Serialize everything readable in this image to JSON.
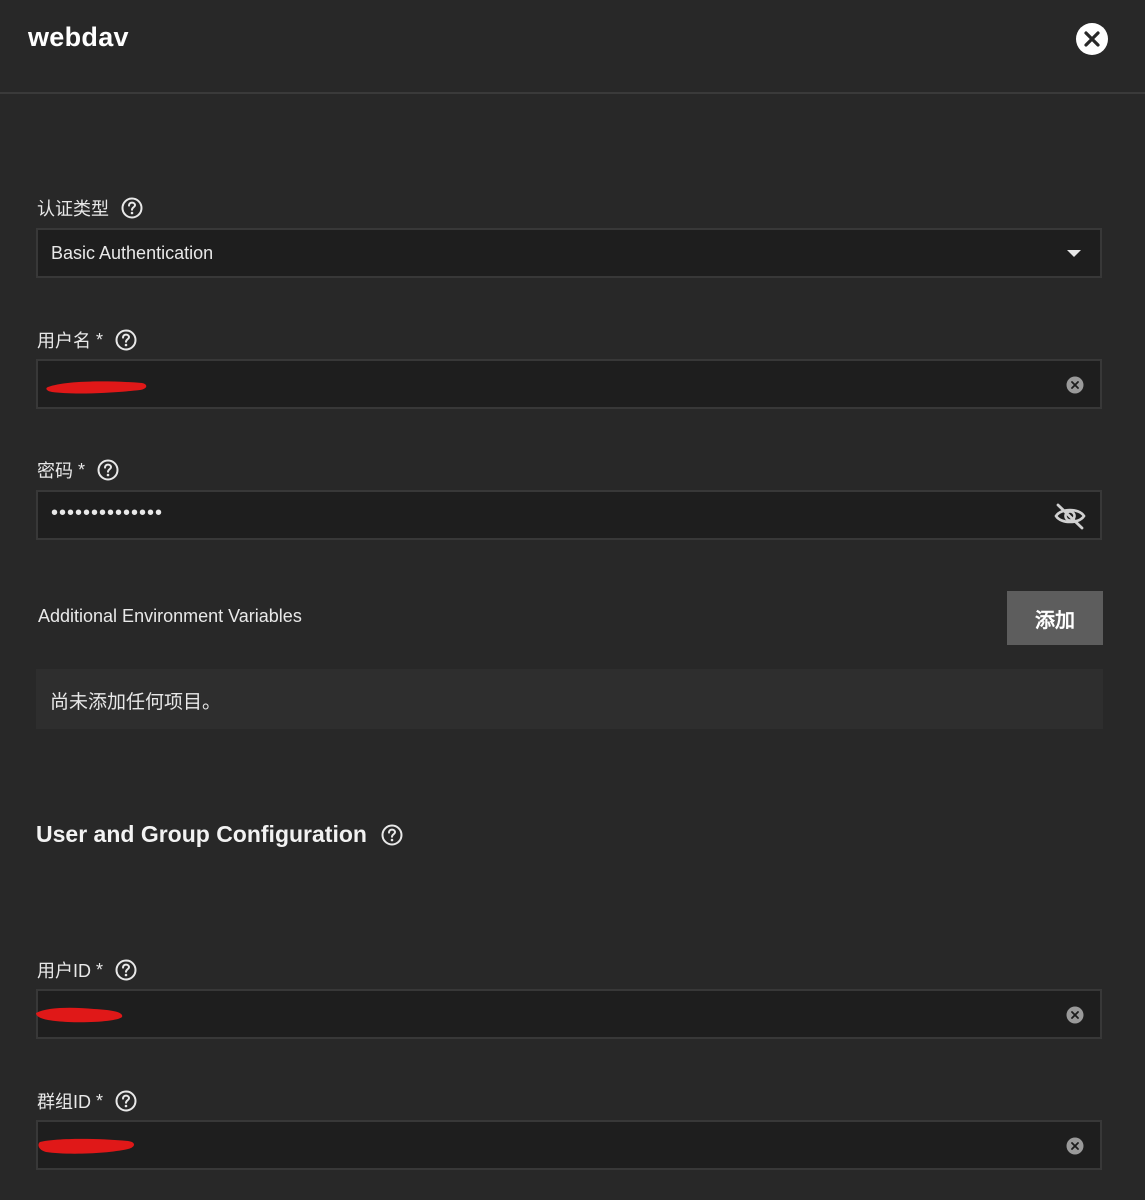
{
  "header": {
    "title": "webdav",
    "close_icon": "close-icon"
  },
  "auth_type": {
    "label": "认证类型",
    "selected": "Basic Authentication"
  },
  "username": {
    "label": "用户名",
    "required_mark": "*"
  },
  "password": {
    "label": "密码",
    "required_mark": "*",
    "value_masked": "••••••••••••••"
  },
  "env": {
    "label": "Additional Environment Variables",
    "add_label": "添加",
    "empty_text": "尚未添加任何项目。"
  },
  "user_group": {
    "title": "User and Group Configuration",
    "user_id": {
      "label": "用户ID",
      "required_mark": "*"
    },
    "group_id": {
      "label": "群组ID",
      "required_mark": "*"
    }
  },
  "colors": {
    "background": "#282828",
    "field_bg": "#1e1e1e",
    "button_bg": "#5d5d5d",
    "redaction": "#e01818"
  }
}
